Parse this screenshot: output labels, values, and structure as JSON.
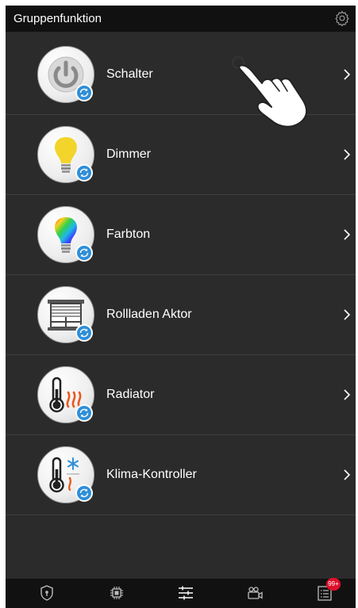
{
  "header": {
    "title": "Gruppenfunktion",
    "settings_icon": "gear-icon"
  },
  "items": [
    {
      "label": "Schalter",
      "icon": "power-icon"
    },
    {
      "label": "Dimmer",
      "icon": "bulb-icon"
    },
    {
      "label": "Farbton",
      "icon": "color-bulb-icon"
    },
    {
      "label": "Rollladen Aktor",
      "icon": "shutter-icon"
    },
    {
      "label": "Radiator",
      "icon": "thermometer-heat-icon"
    },
    {
      "label": "Klima-Kontroller",
      "icon": "thermometer-snow-icon"
    }
  ],
  "bottom_nav": [
    {
      "name": "security",
      "icon": "shield-icon"
    },
    {
      "name": "devices",
      "icon": "chip-icon"
    },
    {
      "name": "group-function",
      "icon": "sliders-icon",
      "active": true
    },
    {
      "name": "camera",
      "icon": "camera-icon"
    },
    {
      "name": "log",
      "icon": "list-icon",
      "badge": "99+"
    }
  ],
  "colors": {
    "background": "#2b2b2b",
    "bar": "#111111",
    "badge_blue": "#2f8fd8",
    "notification_red": "#e0102a"
  }
}
